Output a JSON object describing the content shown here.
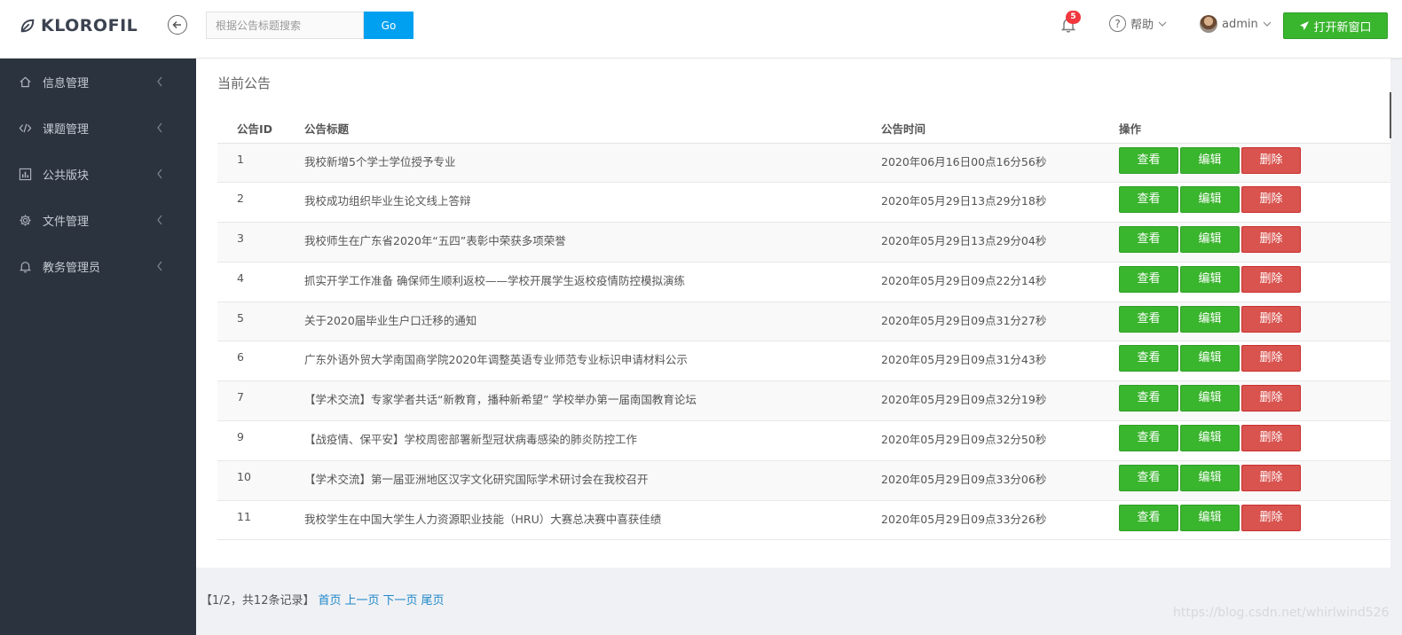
{
  "brand": {
    "name": "KLOROFIL"
  },
  "search": {
    "placeholder": "根据公告标题搜索",
    "button_label": "Go"
  },
  "notifications": {
    "count": "5"
  },
  "help": {
    "label": "帮助"
  },
  "user": {
    "name": "admin"
  },
  "new_window_button": {
    "label": "打开新窗口"
  },
  "sidebar": {
    "items": [
      {
        "label": "信息管理",
        "icon": "home-icon"
      },
      {
        "label": "课题管理",
        "icon": "code-icon"
      },
      {
        "label": "公共版块",
        "icon": "bar-chart-icon"
      },
      {
        "label": "文件管理",
        "icon": "gear-icon"
      },
      {
        "label": "教务管理员",
        "icon": "bell-icon"
      }
    ]
  },
  "main": {
    "title": "当前公告",
    "columns": [
      "公告ID",
      "公告标题",
      "公告时间",
      "操作"
    ],
    "actions": {
      "view": "查看",
      "edit": "编辑",
      "delete": "删除"
    },
    "rows": [
      {
        "id": "1",
        "title": "我校新增5个学士学位授予专业",
        "time": "2020年06月16日00点16分56秒"
      },
      {
        "id": "2",
        "title": "我校成功组织毕业生论文线上答辩",
        "time": "2020年05月29日13点29分18秒"
      },
      {
        "id": "3",
        "title": "我校师生在广东省2020年“五四”表彰中荣获多项荣誉",
        "time": "2020年05月29日13点29分04秒"
      },
      {
        "id": "4",
        "title": "抓实开学工作准备 确保师生顺利返校——学校开展学生返校疫情防控模拟演练",
        "time": "2020年05月29日09点22分14秒"
      },
      {
        "id": "5",
        "title": "关于2020届毕业生户口迁移的通知",
        "time": "2020年05月29日09点31分27秒"
      },
      {
        "id": "6",
        "title": "广东外语外贸大学南国商学院2020年调整英语专业师范专业标识申请材料公示",
        "time": "2020年05月29日09点31分43秒"
      },
      {
        "id": "7",
        "title": "【学术交流】专家学者共话“新教育，播种新希望” 学校举办第一届南国教育论坛",
        "time": "2020年05月29日09点32分19秒"
      },
      {
        "id": "9",
        "title": "【战疫情、保平安】学校周密部署新型冠状病毒感染的肺炎防控工作",
        "time": "2020年05月29日09点32分50秒"
      },
      {
        "id": "10",
        "title": "【学术交流】第一届亚洲地区汉字文化研究国际学术研讨会在我校召开",
        "time": "2020年05月29日09点33分06秒"
      },
      {
        "id": "11",
        "title": "我校学生在中国大学生人力资源职业技能（HRU）大赛总决赛中喜获佳绩",
        "time": "2020年05月29日09点33分26秒"
      }
    ]
  },
  "pagination": {
    "summary": "【1/2，共12条记录】",
    "first": "首页",
    "prev": "上一页",
    "next": "下一页",
    "last": "尾页"
  },
  "watermark": "https://blog.csdn.net/whirlwind526"
}
